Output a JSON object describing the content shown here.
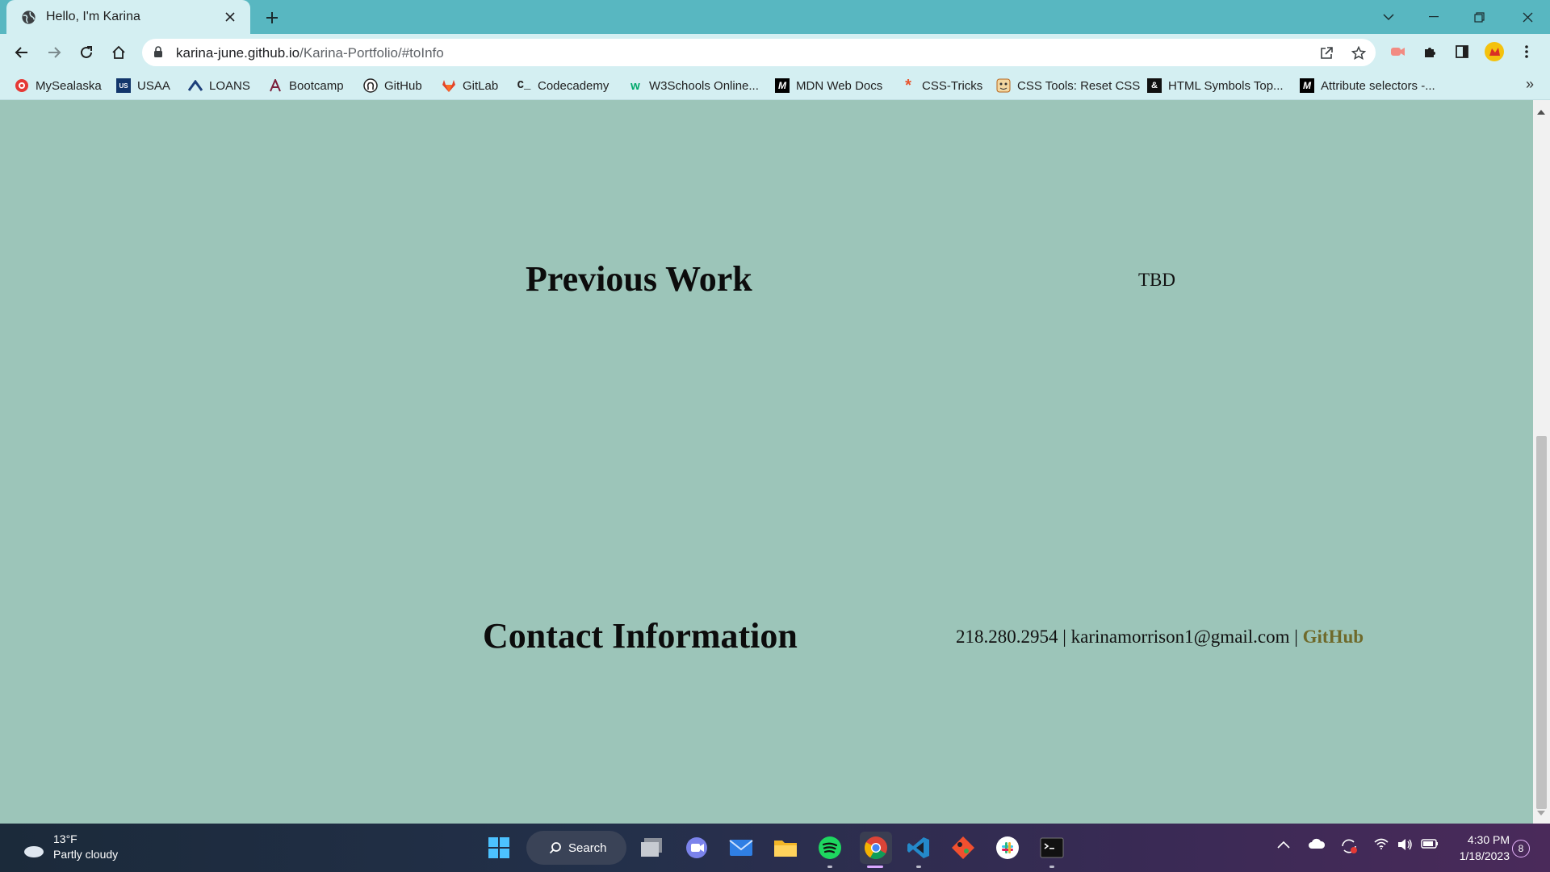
{
  "browser": {
    "tab_title": "Hello, I'm Karina",
    "url_host": "karina-june.github.io",
    "url_path": "/Karina-Portfolio/#toInfo"
  },
  "bookmarks": [
    {
      "label": "MySealaska",
      "icon": "sealaska-icon",
      "color": "#e53935"
    },
    {
      "label": "USAA",
      "icon": "usaa-icon",
      "color": "#12366b"
    },
    {
      "label": "LOANS",
      "icon": "loans-icon",
      "color": "#1d3f7a"
    },
    {
      "label": "Bootcamp",
      "icon": "bootcamp-icon",
      "color": "#7b1e3a"
    },
    {
      "label": "GitHub",
      "icon": "github-icon",
      "color": "#222"
    },
    {
      "label": "GitLab",
      "icon": "gitlab-icon",
      "color": "#e24329"
    },
    {
      "label": "Codecademy",
      "icon": "codecademy-icon",
      "color": "#222"
    },
    {
      "label": "W3Schools Online...",
      "icon": "w3schools-icon",
      "color": "#04aa6d"
    },
    {
      "label": "MDN Web Docs",
      "icon": "mdn-icon",
      "color": "#000"
    },
    {
      "label": "CSS-Tricks",
      "icon": "css-tricks-icon",
      "color": "#e8542d"
    },
    {
      "label": "CSS Tools: Reset CSS",
      "icon": "reset-css-icon",
      "color": "#b5651d"
    },
    {
      "label": "HTML Symbols Top...",
      "icon": "html-symbols-icon",
      "color": "#111"
    },
    {
      "label": "Attribute selectors -...",
      "icon": "mdn-icon",
      "color": "#000"
    }
  ],
  "page": {
    "previous_work": {
      "heading": "Previous Work",
      "content": "TBD"
    },
    "contact": {
      "heading": "Contact Information",
      "phone": "218.280.2954",
      "separator": "|",
      "email": "karinamorrison1@gmail.com",
      "github_label": "GitHub"
    }
  },
  "taskbar": {
    "weather_temp": "13°F",
    "weather_desc": "Partly cloudy",
    "search_label": "Search",
    "time": "4:30 PM",
    "date": "1/18/2023",
    "notification_count": "8"
  },
  "colors": {
    "page_background": "#9cc5b9",
    "link": "#6f6a2b",
    "tabstrip": "#58b7c1"
  }
}
